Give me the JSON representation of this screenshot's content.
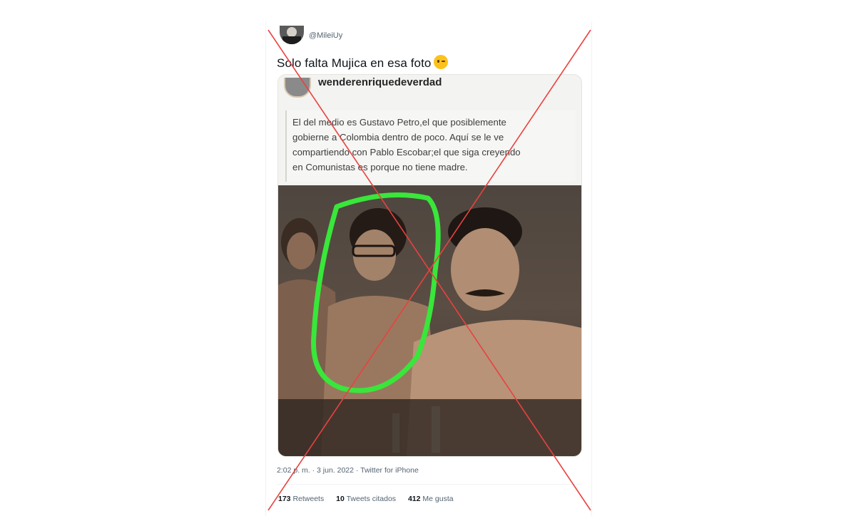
{
  "tweet": {
    "handle": "@MileiUy",
    "text": "Solo falta Mujica en esa foto",
    "emoji": "winking-face-emoji",
    "timestamp": "2:02 p. m. · 3 jun. 2022 · Twitter for iPhone",
    "stats": {
      "retweets_count": "173",
      "retweets_label": "Retweets",
      "quotes_count": "10",
      "quotes_label": "Tweets citados",
      "likes_count": "412",
      "likes_label": "Me gusta"
    }
  },
  "embedded_post": {
    "username": "wenderenriquedeverdad",
    "caption_lines": [
      "El del medio es Gustavo Petro,el que posiblemente",
      "gobierne a Colombia dentro de poco. Aquí se le ve",
      "compartiendo con Pablo Escobar;el que siga creyendo",
      "en Comunistas es porque no tiene madre."
    ]
  },
  "colors": {
    "overlay_cross": "#e8423f",
    "highlight_circle": "#39e63a",
    "text_primary": "#0f1419",
    "text_secondary": "#536471"
  }
}
